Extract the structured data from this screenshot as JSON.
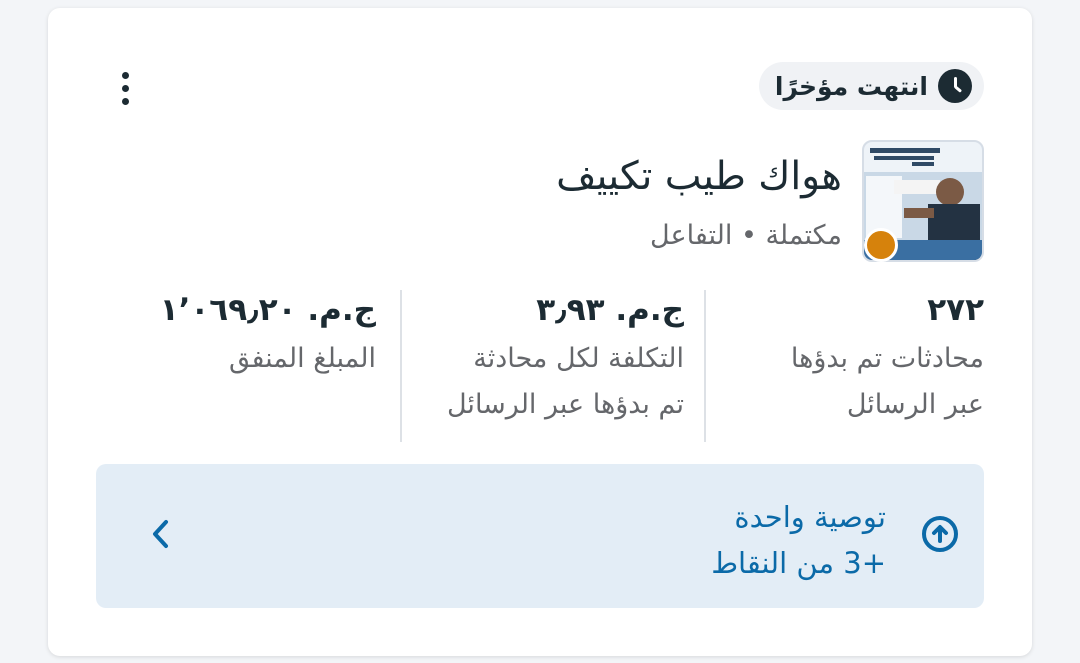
{
  "status": {
    "label": "انتهت مؤخرًا",
    "icon": "clock-icon"
  },
  "menu": {
    "icon": "more-vertical-icon"
  },
  "campaign": {
    "name": "هواك طيب تكييف",
    "meta": "مكتملة • التفاعل",
    "status_dot_color": "#d6820c"
  },
  "metrics": [
    {
      "value": "٢٧٢",
      "label_line1": "محادثات تم بدؤها",
      "label_line2": "عبر الرسائل"
    },
    {
      "value": "ج.م. ٣٫٩٣",
      "label_line1": "التكلفة لكل محادثة",
      "label_line2": "تم بدؤها عبر الرسائل"
    },
    {
      "value": "ج.م. ١٬٠٦٩٫٢٠",
      "label_line1": "المبلغ المنفق",
      "label_line2": ""
    }
  ],
  "recommendation": {
    "title": "توصية واحدة",
    "points": "+3 من النقاط",
    "icon": "arrow-up-circle-icon",
    "chevron_icon": "chevron-left-icon",
    "accent_color": "#0b6aa8"
  }
}
